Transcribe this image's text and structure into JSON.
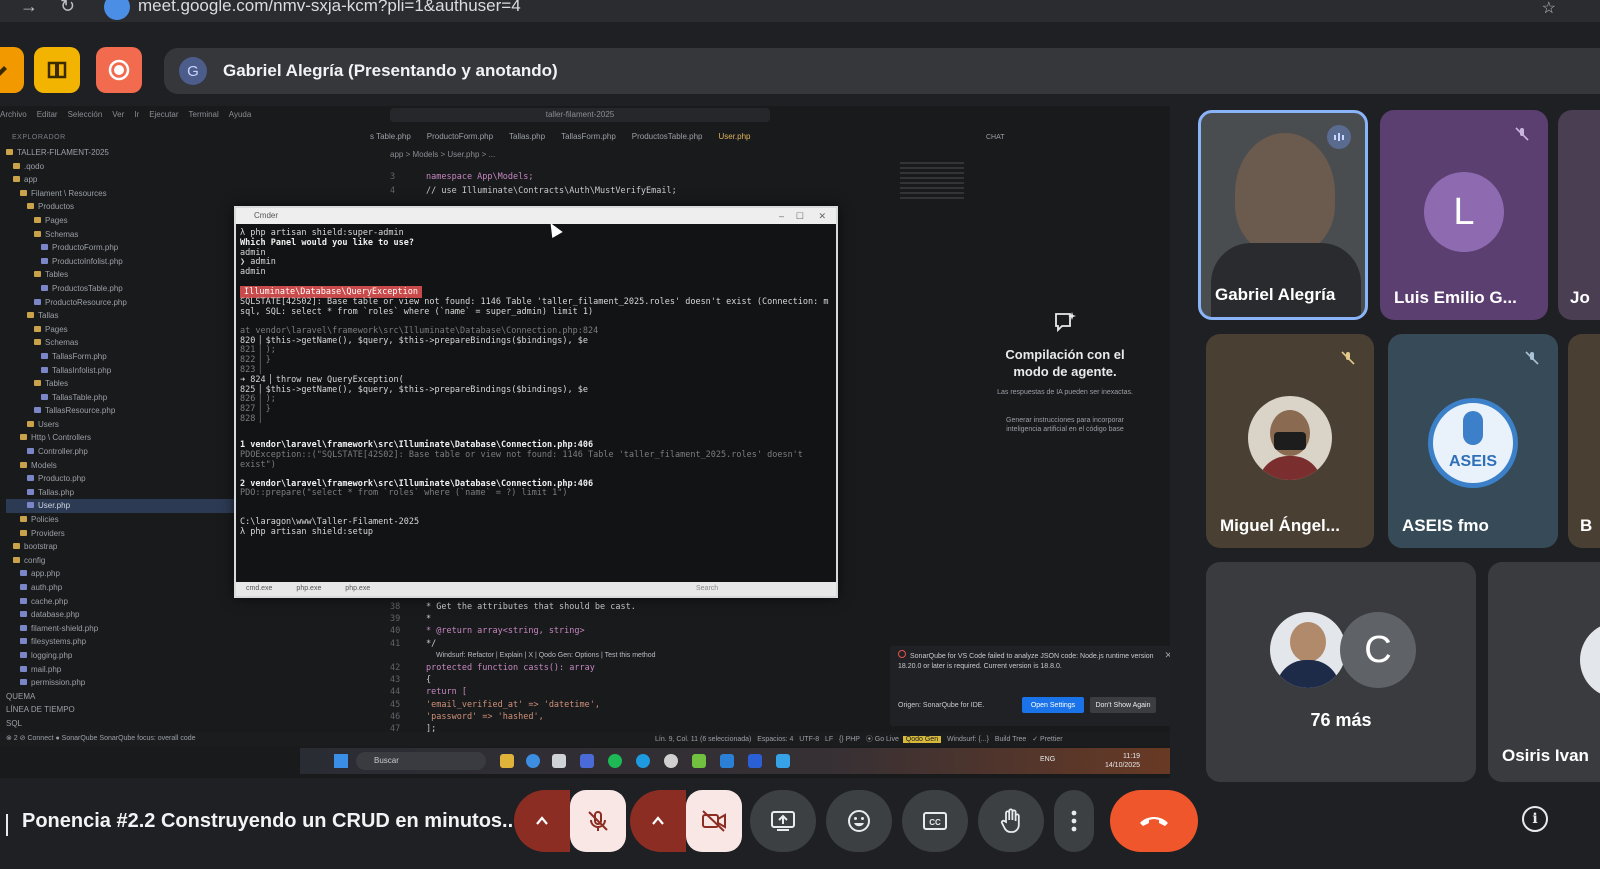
{
  "browser": {
    "url": "meet.google.com/nmv-sxja-kcm?pli=1&authuser=4"
  },
  "presenter": {
    "avatar_letter": "G",
    "label": "Gabriel Alegría (Presentando y anotando)"
  },
  "shared_screen": {
    "menu": [
      "Archivo",
      "Editar",
      "Selección",
      "Ver",
      "Ir",
      "Ejecutar",
      "Terminal",
      "Ayuda"
    ],
    "search_box": "taller-filament-2025",
    "explorer_title": "EXPLORADOR",
    "explorer_tree": [
      {
        "label": "TALLER-FILAMENT-2025",
        "kind": "folder",
        "indent": 0
      },
      {
        "label": ".qodo",
        "kind": "folder",
        "indent": 1
      },
      {
        "label": "app",
        "kind": "folder",
        "indent": 1
      },
      {
        "label": "Filament \\ Resources",
        "kind": "folder",
        "indent": 2
      },
      {
        "label": "Productos",
        "kind": "folder",
        "indent": 3
      },
      {
        "label": "Pages",
        "kind": "folder",
        "indent": 4
      },
      {
        "label": "Schemas",
        "kind": "folder",
        "indent": 4
      },
      {
        "label": "ProductoForm.php",
        "kind": "php",
        "indent": 5
      },
      {
        "label": "ProductoInfolist.php",
        "kind": "php",
        "indent": 5
      },
      {
        "label": "Tables",
        "kind": "folder",
        "indent": 4
      },
      {
        "label": "ProductosTable.php",
        "kind": "php",
        "indent": 5
      },
      {
        "label": "ProductoResource.php",
        "kind": "php",
        "indent": 4
      },
      {
        "label": "Tallas",
        "kind": "folder",
        "indent": 3
      },
      {
        "label": "Pages",
        "kind": "folder",
        "indent": 4
      },
      {
        "label": "Schemas",
        "kind": "folder",
        "indent": 4
      },
      {
        "label": "TallasForm.php",
        "kind": "php",
        "indent": 5
      },
      {
        "label": "TallasInfolist.php",
        "kind": "php",
        "indent": 5
      },
      {
        "label": "Tables",
        "kind": "folder",
        "indent": 4
      },
      {
        "label": "TallasTable.php",
        "kind": "php",
        "indent": 5
      },
      {
        "label": "TallasResource.php",
        "kind": "php",
        "indent": 4
      },
      {
        "label": "Users",
        "kind": "folder",
        "indent": 3
      },
      {
        "label": "Http \\ Controllers",
        "kind": "folder",
        "indent": 2
      },
      {
        "label": "Controller.php",
        "kind": "php",
        "indent": 3
      },
      {
        "label": "Models",
        "kind": "folder",
        "indent": 2
      },
      {
        "label": "Producto.php",
        "kind": "php",
        "indent": 3
      },
      {
        "label": "Tallas.php",
        "kind": "php",
        "indent": 3
      },
      {
        "label": "User.php",
        "kind": "php",
        "indent": 3,
        "active": true
      },
      {
        "label": "Policies",
        "kind": "folder",
        "indent": 2
      },
      {
        "label": "Providers",
        "kind": "folder",
        "indent": 2
      },
      {
        "label": "bootstrap",
        "kind": "folder",
        "indent": 1
      },
      {
        "label": "config",
        "kind": "folder",
        "indent": 1
      },
      {
        "label": "app.php",
        "kind": "php",
        "indent": 2
      },
      {
        "label": "auth.php",
        "kind": "php",
        "indent": 2
      },
      {
        "label": "cache.php",
        "kind": "php",
        "indent": 2
      },
      {
        "label": "database.php",
        "kind": "php",
        "indent": 2
      },
      {
        "label": "filament-shield.php",
        "kind": "php",
        "indent": 2
      },
      {
        "label": "filesystems.php",
        "kind": "php",
        "indent": 2
      },
      {
        "label": "logging.php",
        "kind": "php",
        "indent": 2
      },
      {
        "label": "mail.php",
        "kind": "php",
        "indent": 2
      },
      {
        "label": "permission.php",
        "kind": "php",
        "indent": 2
      },
      {
        "label": "QUEMA",
        "kind": "section",
        "indent": 0
      },
      {
        "label": "LÍNEA DE TIEMPO",
        "kind": "section",
        "indent": 0
      },
      {
        "label": "SQL",
        "kind": "section",
        "indent": 0
      }
    ],
    "editor_tabs": [
      {
        "label": "s Table.php",
        "active": false
      },
      {
        "label": "ProductoForm.php",
        "active": false
      },
      {
        "label": "Tallas.php",
        "active": false
      },
      {
        "label": "TallasForm.php",
        "active": false
      },
      {
        "label": "ProductosTable.php",
        "active": false
      },
      {
        "label": "User.php",
        "active": true
      }
    ],
    "breadcrumb": "app > Models > User.php > ...",
    "code_top": [
      {
        "num": "3",
        "text": "namespace App\\Models;"
      },
      {
        "num": "4",
        "text": "// use Illuminate\\Contracts\\Auth\\MustVerifyEmail;"
      }
    ],
    "code_bottom": [
      {
        "num": "38",
        "text": "* Get the attributes that should be cast."
      },
      {
        "num": "39",
        "text": "*"
      },
      {
        "num": "40",
        "text": "* @return array<string, string>"
      },
      {
        "num": "41",
        "text": "*/"
      },
      {
        "num": "",
        "text": "Windsurf: Refactor | Explain | X | Qodo Gen: Options | Test this method"
      },
      {
        "num": "42",
        "text": "protected function casts(): array"
      },
      {
        "num": "43",
        "text": "{"
      },
      {
        "num": "44",
        "text": "return ["
      },
      {
        "num": "45",
        "text": "'email_verified_at' => 'datetime',"
      },
      {
        "num": "46",
        "text": "'password' => 'hashed',"
      },
      {
        "num": "47",
        "text": "];"
      }
    ],
    "chat": {
      "label": "CHAT",
      "title": "Compilación con el modo de agente.",
      "subtitle": "Las respuestas de IA pueden ser inexactas.",
      "hint": "Generar instrucciones para incorporar inteligencia artificial en el código base"
    },
    "sonar_toast": {
      "message": "SonarQube for VS Code failed to analyze JSON code: Node.js runtime version 18.20.0 or later is required. Current version is 18.8.0.",
      "origin": "Origen: SonarQube for IDE.",
      "open_settings": "Open Settings",
      "dont_show": "Don't Show Again"
    },
    "statusbar": {
      "left": "⊗ 2   ⊘ Connect   ● SonarQube   SonarQube focus: overall code",
      "right_position": "Lín. 9, Col. 11 (6 seleccionada)",
      "right_spaces": "Espacios: 4",
      "right_encoding": "UTF-8",
      "right_eol": "LF",
      "right_lang": "{} PHP",
      "right_golive": "⦿ Go Live",
      "right_qodo": "Qodo Gen",
      "right_windsurf": "Windsurf: {...}",
      "right_buildtree": "Build Tree",
      "right_prettier": "✓ Prettier"
    },
    "taskbar": {
      "search": "Buscar",
      "lang": "ENG",
      "time": "11:19",
      "date": "14/10/2025"
    },
    "terminal": {
      "title": "Cmder",
      "lines": [
        {
          "t": "λ php artisan shield:super-admin",
          "cls": ""
        },
        {
          "t": " Which Panel would you like to use?",
          "cls": "b"
        },
        {
          "t": " admin",
          "cls": ""
        },
        {
          "t": " ❯ admin",
          "cls": ""
        },
        {
          "t": " admin",
          "cls": ""
        },
        {
          "t": "Illuminate\\Database\\QueryException",
          "cls": "exc"
        },
        {
          "t": "SQLSTATE[42S02]: Base table or view not found: 1146 Table 'taller_filament_2025.roles' doesn't exist (Connection: m",
          "cls": ""
        },
        {
          "t": "sql, SQL: select * from `roles` where (`name` = super_admin) limit 1)",
          "cls": ""
        },
        {
          "t": "at vendor\\laravel\\framework\\src\\Illuminate\\Database\\Connection.php:824",
          "cls": "dim"
        },
        {
          "t": "  820▕             $this->getName(), $query, $this->prepareBindings($bindings), $e",
          "cls": ""
        },
        {
          "t": "  821▕           );",
          "cls": "dim"
        },
        {
          "t": "  822▕         }",
          "cls": "dim"
        },
        {
          "t": "  823▕",
          "cls": "dim"
        },
        {
          "t": "➜ 824▕         throw new QueryException(",
          "cls": ""
        },
        {
          "t": "  825▕             $this->getName(), $query, $this->prepareBindings($bindings), $e",
          "cls": ""
        },
        {
          "t": "  826▕           );",
          "cls": "dim"
        },
        {
          "t": "  827▕       }",
          "cls": "dim"
        },
        {
          "t": "  828▕",
          "cls": "dim"
        },
        {
          "t": "  1   vendor\\laravel\\framework\\src\\Illuminate\\Database\\Connection.php:406",
          "cls": "b"
        },
        {
          "t": "      PDOException::(\"SQLSTATE[42S02]: Base table or view not found: 1146 Table 'taller_filament_2025.roles' doesn't",
          "cls": "dim"
        },
        {
          "t": "exist\")",
          "cls": "dim"
        },
        {
          "t": "  2   vendor\\laravel\\framework\\src\\Illuminate\\Database\\Connection.php:406",
          "cls": "b"
        },
        {
          "t": "      PDO::prepare(\"select * from `roles` where (`name` = ?) limit 1\")",
          "cls": "dim"
        },
        {
          "t": "C:\\laragon\\www\\Taller-Filament-2025",
          "cls": ""
        },
        {
          "t": "λ php artisan shield:setup",
          "cls": ""
        }
      ],
      "tabs": [
        "cmd.exe",
        "php.exe",
        "php.exe"
      ],
      "search_placeholder": "Search"
    }
  },
  "participants": [
    {
      "name": "Gabriel Alegría",
      "speaking": true
    },
    {
      "name": "Luis Emilio G...",
      "letter": "L",
      "muted": true
    },
    {
      "name": "Jo"
    },
    {
      "name": "Miguel Ángel...",
      "muted": true
    },
    {
      "name": "ASEIS fmo",
      "muted": true,
      "logo_text": "ASEIS"
    },
    {
      "name": "B"
    },
    {
      "name": "76 más",
      "letter": "C"
    },
    {
      "name": "Osiris Ivan"
    }
  ],
  "meeting_title": "Ponencia #2.2 Construyendo un CRUD en minutos...",
  "colors": {
    "accent_blue": "#8ab4f8",
    "danger_red": "#8c2d24",
    "hangup_orange": "#f0562b",
    "tile_bg": "#3c4043"
  }
}
